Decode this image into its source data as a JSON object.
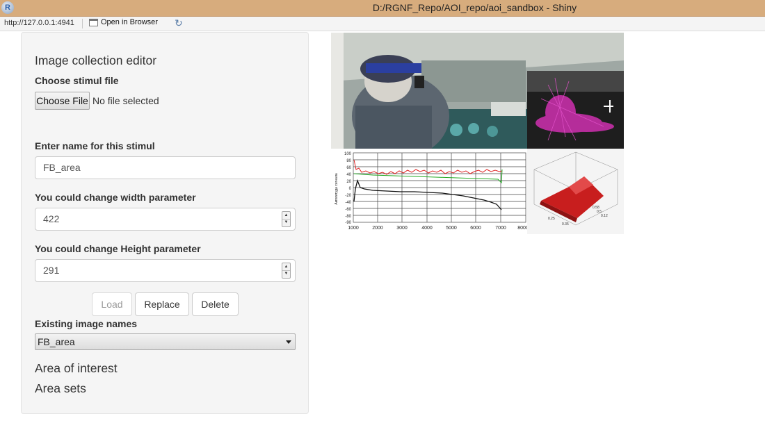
{
  "window": {
    "title": "D:/RGNF_Repo/AOI_repo/aoi_sandbox - Shiny",
    "logo_letter": "R"
  },
  "toolbar": {
    "url": "http://127.0.0.1:4941",
    "open_in_browser": "Open in Browser",
    "refresh_icon": "refresh-icon"
  },
  "sidebar": {
    "title": "Image collection editor",
    "file": {
      "label": "Choose stimul file",
      "button": "Choose File",
      "status": "No file selected"
    },
    "name_field": {
      "label": "Enter name for this stimul",
      "value": "FB_area"
    },
    "width_field": {
      "label": "You could change width parameter",
      "value": "422"
    },
    "height_field": {
      "label": "You could change Height parameter",
      "value": "291"
    },
    "buttons": {
      "load": "Load",
      "replace": "Replace",
      "delete": "Delete"
    },
    "existing": {
      "label": "Existing image names",
      "selected": "FB_area"
    },
    "sections": {
      "area_of_interest": "Area of interest",
      "area_sets": "Area sets"
    }
  },
  "stimulus": {
    "graph_y_ticks": [
      "100",
      "80",
      "60",
      "40",
      "20",
      "0",
      "-20",
      "-40",
      "-60",
      "-80",
      "-90"
    ],
    "graph_x_ticks": [
      "1000",
      "2000",
      "3000",
      "4000",
      "5000",
      "6000",
      "7000",
      "8000"
    ],
    "graph_y_label": "Амплитуда сигнала",
    "surface_axis_labels": [
      "0.58",
      "0.5",
      "0.12",
      "0.25",
      "0.35"
    ],
    "colors": {
      "line_red": "#d22",
      "line_green": "#2a2",
      "line_black": "#111",
      "surface_red": "#c81e1e",
      "heat_magenta": "#d030b0"
    }
  }
}
